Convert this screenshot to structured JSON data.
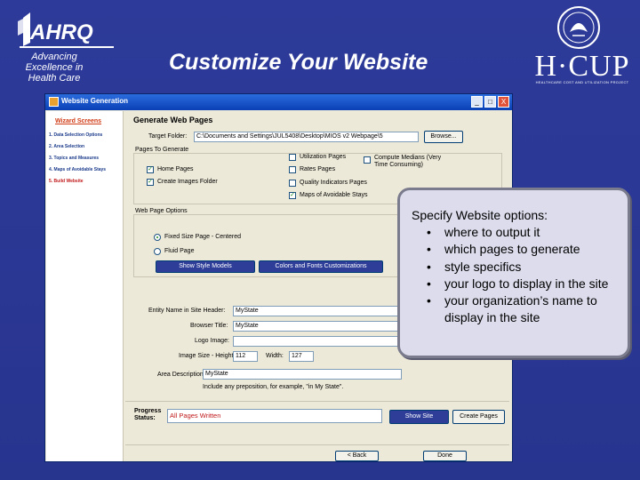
{
  "slide": {
    "title": "Customize Your Website",
    "ahrq_tagline": "Advancing Excellence in Health Care",
    "ahrq_logo_text": "AHRQ",
    "hcup_logo_text": "H·CUP",
    "hcup_subtitle": "HEALTHCARE COST AND UTILIZATION PROJECT"
  },
  "window": {
    "title": "Website Generation",
    "controls": [
      "_",
      "□",
      "X"
    ]
  },
  "sidebar": {
    "heading": "Wizard Screens",
    "items": [
      {
        "label": "1. Data Selection Options",
        "active": false
      },
      {
        "label": "2. Area Selection",
        "active": false
      },
      {
        "label": "3. Topics and Measures",
        "active": false
      },
      {
        "label": "4. Maps of Avoidable Stays",
        "active": false
      },
      {
        "label": "5. Build Website",
        "active": true
      }
    ]
  },
  "main": {
    "heading": "Generate Web Pages",
    "target_folder_label": "Target Folder:",
    "target_folder_value": "C:\\Documents and Settings\\JUL5408\\Desktop\\MIOS v2 Webpage\\5",
    "browse_button": "Browse...",
    "pages_label": "Pages To Generate",
    "checkboxes": [
      {
        "label": "Home Pages",
        "checked": true
      },
      {
        "label": "Create Images Folder",
        "checked": true
      },
      {
        "label": "Utilization Pages",
        "checked": false
      },
      {
        "label": "Rates Pages",
        "checked": false
      },
      {
        "label": "Quality Indicators Pages",
        "checked": false
      },
      {
        "label": "Maps of Avoidable Stays",
        "checked": true
      }
    ],
    "compute_medians_label": "Compute Medians (Very Time Consuming)",
    "compute_medians_checked": false,
    "web_page_options_label": "Web Page Options",
    "radio_fixed": "Fixed Size Page - Centered",
    "radio_fluid": "Fluid Page",
    "radio_selected": "fixed",
    "show_style_models_button": "Show Style Models",
    "colors_fonts_button": "Colors and Fonts Customizations",
    "entity_name_label": "Entity Name in Site Header:",
    "entity_name_value": "MyState",
    "browser_title_label": "Browser Title:",
    "browser_title_value": "MyState",
    "logo_image_label": "Logo Image:",
    "logo_image_value": "",
    "image_height_label": "Image Size - Height:",
    "image_height_value": "112",
    "image_width_label": "Width:",
    "image_width_value": "127",
    "area_description_label": "Area Description:",
    "area_description_value": "MyState",
    "area_description_hint": "Include any preposition, for example, \"in My State\".",
    "progress_label": "Progress Status:",
    "progress_value": "All Pages Written",
    "show_site_button": "Show Site",
    "create_pages_button": "Create Pages",
    "back_button": "< Back",
    "done_button": "Done"
  },
  "callout": {
    "heading": "Specify Website options:",
    "bullets": [
      "where to output it",
      "which pages to generate",
      "style specifics",
      "your logo to display in the site",
      "your organization’s name to display in the site"
    ]
  }
}
